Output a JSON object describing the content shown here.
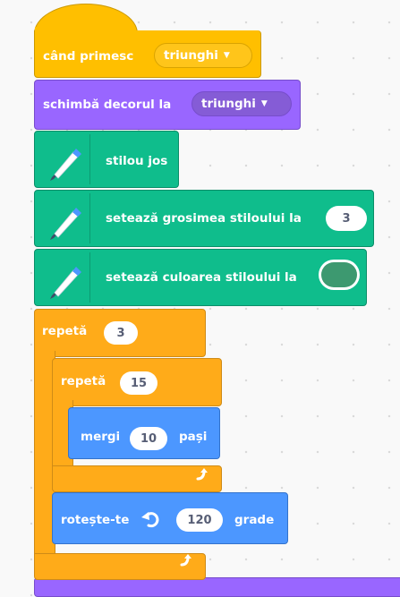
{
  "event_block": {
    "label": "când primesc",
    "message": "triunghi"
  },
  "looks_block": {
    "label": "schimbă decorul la",
    "backdrop": "triunghi"
  },
  "pen_blocks": [
    {
      "label": "stilou jos"
    },
    {
      "label": "setează grosimea stiloului la",
      "value": "3"
    },
    {
      "label": "setează culoarea stiloului la",
      "color": "#3d9970"
    }
  ],
  "outer_repeat": {
    "label": "repetă",
    "value": "3"
  },
  "inner_repeat": {
    "label": "repetă",
    "value": "15"
  },
  "move_block": {
    "label": "mergi",
    "value": "10",
    "suffix": "pași"
  },
  "turn_block": {
    "label": "rotește-te",
    "value": "120",
    "suffix": "grade"
  },
  "icons": {
    "pen": "pen-icon",
    "loop": "loop-arrow-icon",
    "rotate": "rotate-left-icon",
    "dropdown": "dropdown-arrow-icon"
  },
  "colors": {
    "events": "#ffbf00",
    "looks": "#9966ff",
    "pen": "#0fbd8c",
    "control": "#ffab19",
    "motion": "#4c97ff"
  }
}
